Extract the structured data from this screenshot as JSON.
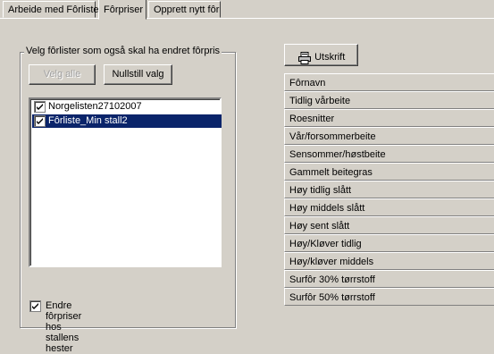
{
  "tabs": [
    "Arbeide med Fôrliste",
    "Fôrpriser",
    "Opprett nytt fôr"
  ],
  "group": {
    "caption": "Velg fôrlister som også skal ha endret fôrpris",
    "select_all_label": "Velg alle",
    "reset_label": "Nullstill valg",
    "items": [
      {
        "label": "Norgelisten27102007",
        "checked": true,
        "selected": false
      },
      {
        "label": "Fôrliste_Min stall2",
        "checked": true,
        "selected": true
      }
    ],
    "bottom_checkbox_label": "Endre fôrpriser hos stallens hester",
    "bottom_checkbox_checked": true
  },
  "print_label": "Utskrift",
  "grid_rows": [
    "Fôrnavn",
    "Tidlig vårbeite",
    "Roesnitter",
    "Vår/forsommerbeite",
    "Sensommer/høstbeite",
    "Gammelt beitegras",
    "Høy tidlig slått",
    "Høy middels slått",
    "Høy sent slått",
    "Høy/Kløver tidlig",
    "Høy/kløver middels",
    "Surfôr 30% tørrstoff",
    "Surfôr 50% tørrstoff"
  ],
  "icons": {
    "print": "printer-icon",
    "check": "checkmark-icon"
  }
}
